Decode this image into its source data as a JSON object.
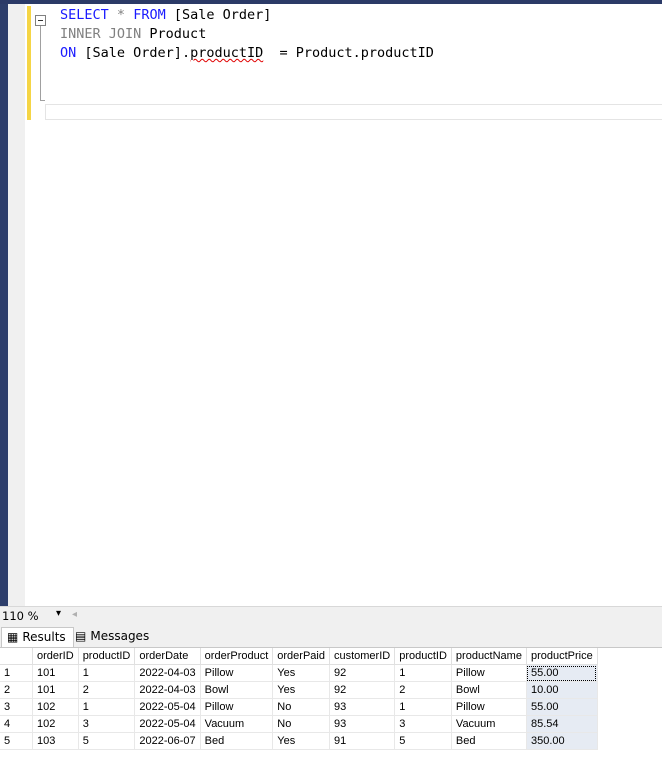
{
  "editor": {
    "line1_kw1": "SELECT",
    "line1_star": "*",
    "line1_kw2": "FROM",
    "line1_table": "[Sale Order]",
    "line2_kw": "INNER JOIN",
    "line2_table": "Product",
    "line3_kw": "ON",
    "line3_a": "[Sale Order].",
    "line3_b": "productID",
    "line3_c": "  = Product.productID"
  },
  "zoom": {
    "value": "110 %"
  },
  "tabs": {
    "results": "Results",
    "messages": "Messages"
  },
  "results": {
    "columns": [
      "orderID",
      "productID",
      "orderDate",
      "orderProduct",
      "orderPaid",
      "customerID",
      "productID",
      "productName",
      "productPrice"
    ],
    "rows": [
      [
        "1",
        "101",
        "1",
        "2022-04-03",
        "Pillow",
        "Yes",
        "92",
        "1",
        "Pillow",
        "55.00"
      ],
      [
        "2",
        "101",
        "2",
        "2022-04-03",
        "Bowl",
        "Yes",
        "92",
        "2",
        "Bowl",
        "10.00"
      ],
      [
        "3",
        "102",
        "1",
        "2022-05-04",
        "Pillow",
        "No",
        "93",
        "1",
        "Pillow",
        "55.00"
      ],
      [
        "4",
        "102",
        "3",
        "2022-05-04",
        "Vacuum",
        "No",
        "93",
        "3",
        "Vacuum",
        "85.54"
      ],
      [
        "5",
        "103",
        "5",
        "2022-06-07",
        "Bed",
        "Yes",
        "91",
        "5",
        "Bed",
        "350.00"
      ]
    ]
  }
}
